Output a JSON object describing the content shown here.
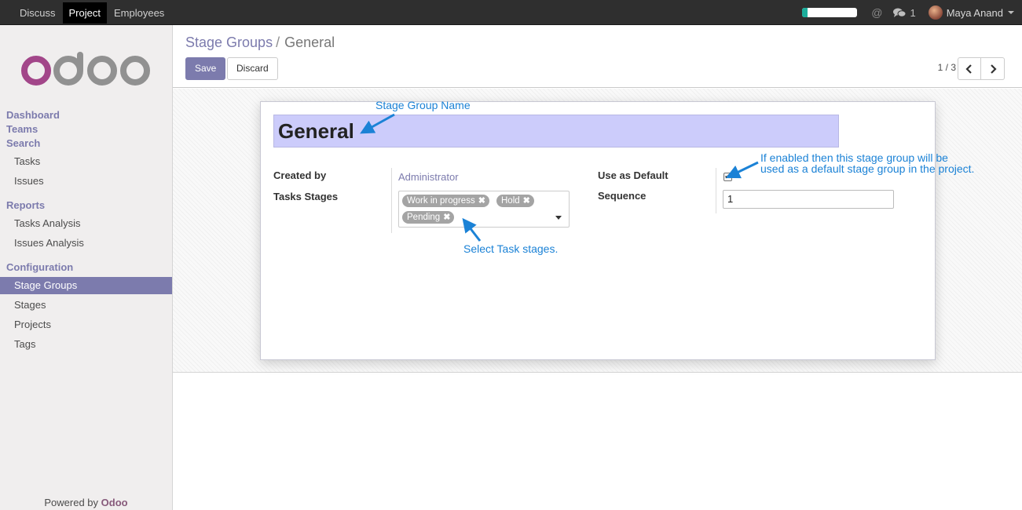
{
  "topbar": {
    "menu": [
      "Discuss",
      "Project",
      "Employees"
    ],
    "progress": 0.1,
    "at_symbol": "@",
    "messages_count": "1",
    "user_name": "Maya Anand"
  },
  "sidebar": {
    "logo_text": "odoo",
    "top_links": [
      "Dashboard",
      "Teams",
      "Search"
    ],
    "search_items": [
      "Tasks",
      "Issues"
    ],
    "reports_header": "Reports",
    "reports_items": [
      "Tasks Analysis",
      "Issues Analysis"
    ],
    "config_header": "Configuration",
    "config_items": [
      "Stage Groups",
      "Stages",
      "Projects",
      "Tags"
    ],
    "powered_prefix": "Powered by",
    "powered_brand": "Odoo"
  },
  "control_panel": {
    "breadcrumb_parent": "Stage Groups",
    "breadcrumb_sep": "/",
    "breadcrumb_current": "General",
    "save_label": "Save",
    "discard_label": "Discard",
    "pager": "1 / 3"
  },
  "form": {
    "name": "General",
    "created_by_label": "Created by",
    "created_by_value": "Administrator",
    "tasks_stages_label": "Tasks Stages",
    "stage_tags": [
      "Work in progress",
      "Hold",
      "Pending"
    ],
    "use_default_label": "Use as Default",
    "use_default_checked": true,
    "sequence_label": "Sequence",
    "sequence_value": "1"
  },
  "annotations": {
    "name_note": "Stage Group Name",
    "default_note_line1": "If enabled then this stage group will be",
    "default_note_line2": "used as a default stage group in the project.",
    "stages_note": "Select Task stages."
  },
  "colors": {
    "brand": "#7c7bad",
    "annotation": "#1b82d6",
    "title_bg": "#ccccfb"
  }
}
